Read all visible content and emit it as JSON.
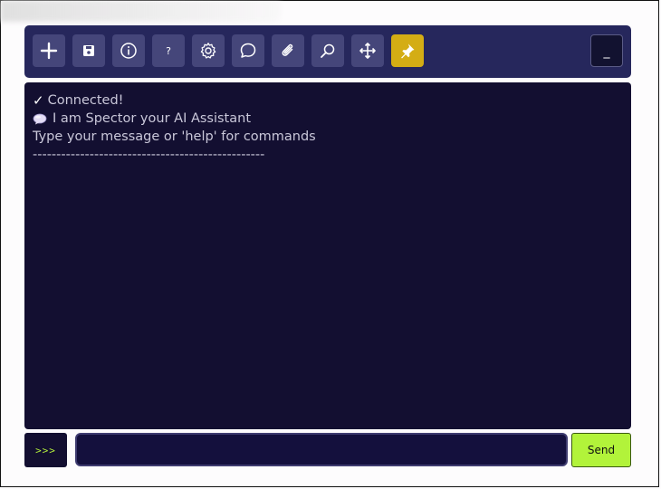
{
  "toolbar": {
    "buttons": [
      {
        "name": "add-icon",
        "active": false
      },
      {
        "name": "save-icon",
        "active": false
      },
      {
        "name": "info-icon",
        "active": false
      },
      {
        "name": "help-icon",
        "label": "?",
        "active": false
      },
      {
        "name": "settings-icon",
        "active": false
      },
      {
        "name": "chat-icon",
        "active": false
      },
      {
        "name": "attachment-icon",
        "active": false
      },
      {
        "name": "search-icon",
        "active": false
      },
      {
        "name": "move-icon",
        "active": false
      },
      {
        "name": "pin-icon",
        "active": true
      }
    ],
    "minimize_label": "_"
  },
  "console": {
    "check_mark": "✓",
    "connected": "Connected!",
    "intro": "I am Spector your AI Assistant",
    "hint": "Type your message or 'help' for commands",
    "divider": "-------------------------------------------------"
  },
  "input": {
    "prompt_label": ">>>",
    "value": "",
    "send_label": "Send"
  },
  "colors": {
    "toolbar_bg": "#26275c",
    "console_bg": "#130f31",
    "accent_yellow": "#d4ad14",
    "send_green": "#b2f33a"
  }
}
